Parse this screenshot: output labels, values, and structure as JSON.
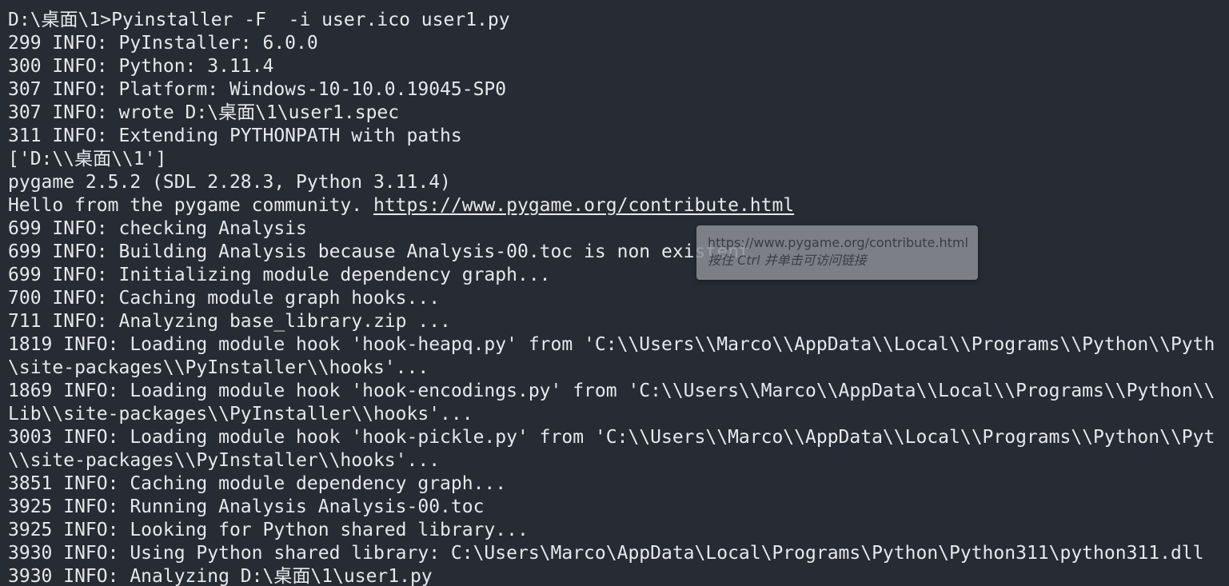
{
  "terminal": {
    "lines": [
      {
        "text": "D:\\桌面\\1>Pyinstaller -F  -i user.ico user1.py"
      },
      {
        "text": "299 INFO: PyInstaller: 6.0.0"
      },
      {
        "text": "300 INFO: Python: 3.11.4"
      },
      {
        "text": "307 INFO: Platform: Windows-10-10.0.19045-SP0"
      },
      {
        "text": "307 INFO: wrote D:\\桌面\\1\\user1.spec"
      },
      {
        "text": "311 INFO: Extending PYTHONPATH with paths"
      },
      {
        "text": "['D:\\\\桌面\\\\1']"
      },
      {
        "text": "pygame 2.5.2 (SDL 2.28.3, Python 3.11.4)"
      },
      {
        "text": "Hello from the pygame community. ",
        "link": "https://www.pygame.org/contribute.html"
      },
      {
        "text": "699 INFO: checking Analysis"
      },
      {
        "text": "699 INFO: Building Analysis because Analysis-00.toc is non existent"
      },
      {
        "text": "699 INFO: Initializing module dependency graph..."
      },
      {
        "text": "700 INFO: Caching module graph hooks..."
      },
      {
        "text": "711 INFO: Analyzing base_library.zip ..."
      },
      {
        "text": "1819 INFO: Loading module hook 'hook-heapq.py' from 'C:\\\\Users\\\\Marco\\\\AppData\\\\Local\\\\Programs\\\\Python\\\\Pyth"
      },
      {
        "text": "\\site-packages\\\\PyInstaller\\\\hooks'..."
      },
      {
        "text": "1869 INFO: Loading module hook 'hook-encodings.py' from 'C:\\\\Users\\\\Marco\\\\AppData\\\\Local\\\\Programs\\\\Python\\\\"
      },
      {
        "text": "Lib\\\\site-packages\\\\PyInstaller\\\\hooks'..."
      },
      {
        "text": "3003 INFO: Loading module hook 'hook-pickle.py' from 'C:\\\\Users\\\\Marco\\\\AppData\\\\Local\\\\Programs\\\\Python\\\\Pyt"
      },
      {
        "text": "\\\\site-packages\\\\PyInstaller\\\\hooks'..."
      },
      {
        "text": "3851 INFO: Caching module dependency graph..."
      },
      {
        "text": "3925 INFO: Running Analysis Analysis-00.toc"
      },
      {
        "text": "3925 INFO: Looking for Python shared library..."
      },
      {
        "text": "3930 INFO: Using Python shared library: C:\\Users\\Marco\\AppData\\Local\\Programs\\Python\\Python311\\python311.dll"
      },
      {
        "text": "3930 INFO: Analyzing D:\\桌面\\1\\user1.py"
      }
    ]
  },
  "tooltip": {
    "url": "https://www.pygame.org/contribute.html",
    "hint": "按住 Ctrl 并单击可访问链接"
  }
}
